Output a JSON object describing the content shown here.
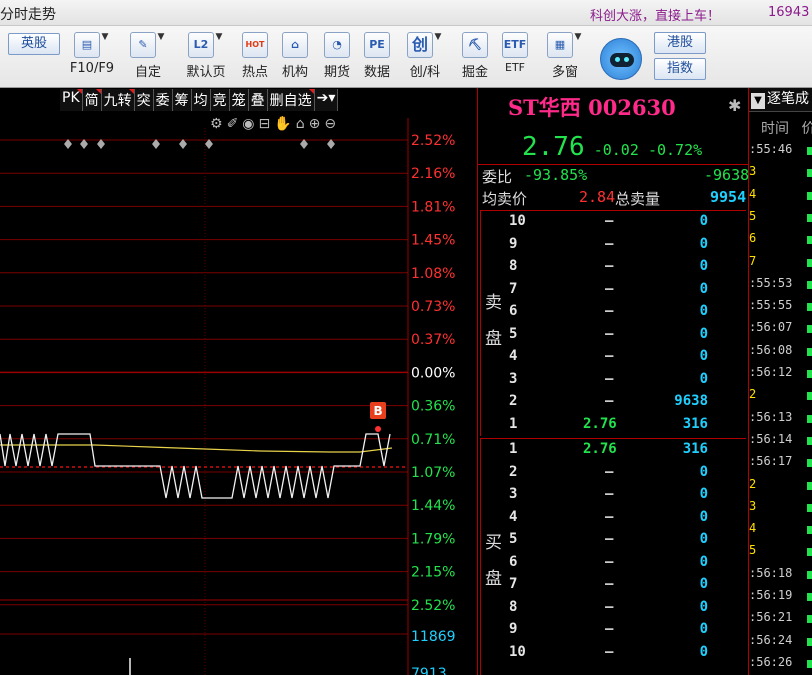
{
  "window": {
    "title": "分时走势",
    "slogan": "科创大涨，直接上车！",
    "phone": "16943"
  },
  "toolbar": {
    "hk_stock": "英股",
    "f10": "F10/F9",
    "custom": "自定",
    "default_page": "默认页",
    "hot": "热点",
    "institution": "机构",
    "futures": "期货",
    "data": "数据",
    "chuang_ke": "创/科",
    "juejin": "掘金",
    "etf": "ETF",
    "multi_window": "多窗",
    "hk_shares": "港股",
    "index": "指数",
    "icon_text": {
      "default_page": "L2",
      "hot": "HOT",
      "data": "PE",
      "chuang": "创",
      "etf": "ETF"
    }
  },
  "chart": {
    "tabs": [
      "PK",
      "简",
      "九转",
      "突",
      "委",
      "筹",
      "均",
      "竞",
      "笼",
      "叠",
      "删自选"
    ],
    "tools_icons": [
      "settings-icon",
      "pen-icon",
      "eye-icon",
      "lock-icon",
      "hand-icon",
      "lock-closed-icon",
      "zoom-in-icon",
      "zoom-out-icon"
    ],
    "y_labels": [
      {
        "text": "2.52%",
        "color": "#ff3030"
      },
      {
        "text": "2.16%",
        "color": "#ff3030"
      },
      {
        "text": "1.81%",
        "color": "#ff3030"
      },
      {
        "text": "1.45%",
        "color": "#ff3030"
      },
      {
        "text": "1.08%",
        "color": "#ff3030"
      },
      {
        "text": "0.73%",
        "color": "#ff3030"
      },
      {
        "text": "0.37%",
        "color": "#ff3030"
      },
      {
        "text": "0.00%",
        "color": "#ffffff"
      },
      {
        "text": "0.36%",
        "color": "#22e34d"
      },
      {
        "text": "0.71%",
        "color": "#22e34d"
      },
      {
        "text": "1.07%",
        "color": "#22e34d"
      },
      {
        "text": "1.44%",
        "color": "#22e34d"
      },
      {
        "text": "1.79%",
        "color": "#22e34d"
      },
      {
        "text": "2.15%",
        "color": "#22e34d"
      },
      {
        "text": "2.52%",
        "color": "#22e34d"
      }
    ],
    "volume_labels": [
      "11869",
      "7913"
    ],
    "marker": "B"
  },
  "quote": {
    "name": "ST华西",
    "code": "002630",
    "price": "2.76",
    "change": "-0.02",
    "pct": "-0.72%",
    "weibi_label": "委比",
    "weibi_pct": "-93.85%",
    "weibi_val": "-9638",
    "avg_sell_label": "均卖价",
    "avg_sell_price": "2.84",
    "total_sell_label": "总卖量",
    "total_sell": "9954",
    "sell_side": [
      "卖",
      "盘"
    ],
    "buy_side": [
      "买",
      "盘"
    ],
    "sell_levels": [
      {
        "n": "10",
        "p": "–",
        "v": "0"
      },
      {
        "n": "9",
        "p": "–",
        "v": "0"
      },
      {
        "n": "8",
        "p": "–",
        "v": "0"
      },
      {
        "n": "7",
        "p": "–",
        "v": "0"
      },
      {
        "n": "6",
        "p": "–",
        "v": "0"
      },
      {
        "n": "5",
        "p": "–",
        "v": "0"
      },
      {
        "n": "4",
        "p": "–",
        "v": "0"
      },
      {
        "n": "3",
        "p": "–",
        "v": "0"
      },
      {
        "n": "2",
        "p": "–",
        "v": "9638"
      },
      {
        "n": "1",
        "p": "2.76",
        "v": "316"
      }
    ],
    "buy_levels": [
      {
        "n": "1",
        "p": "2.76",
        "v": "316"
      },
      {
        "n": "2",
        "p": "–",
        "v": "0"
      },
      {
        "n": "3",
        "p": "–",
        "v": "0"
      },
      {
        "n": "4",
        "p": "–",
        "v": "0"
      },
      {
        "n": "5",
        "p": "–",
        "v": "0"
      },
      {
        "n": "6",
        "p": "–",
        "v": "0"
      },
      {
        "n": "7",
        "p": "–",
        "v": "0"
      },
      {
        "n": "8",
        "p": "–",
        "v": "0"
      },
      {
        "n": "9",
        "p": "–",
        "v": "0"
      },
      {
        "n": "10",
        "p": "–",
        "v": "0"
      }
    ]
  },
  "ticks": {
    "header": "逐笔成",
    "col_time": "时间",
    "col_price": "价",
    "rows": [
      {
        "t": ":55:46",
        "c": "#cfcfcf"
      },
      {
        "t": "3",
        "c": "#ffe000"
      },
      {
        "t": "4",
        "c": "#ffe000"
      },
      {
        "t": "5",
        "c": "#ffe000"
      },
      {
        "t": "6",
        "c": "#ffe000"
      },
      {
        "t": "7",
        "c": "#ffe000"
      },
      {
        "t": ":55:53",
        "c": "#cfcfcf"
      },
      {
        "t": ":55:55",
        "c": "#cfcfcf"
      },
      {
        "t": ":56:07",
        "c": "#cfcfcf"
      },
      {
        "t": ":56:08",
        "c": "#cfcfcf"
      },
      {
        "t": ":56:12",
        "c": "#cfcfcf"
      },
      {
        "t": "2",
        "c": "#ffe000"
      },
      {
        "t": ":56:13",
        "c": "#cfcfcf"
      },
      {
        "t": ":56:14",
        "c": "#cfcfcf"
      },
      {
        "t": ":56:17",
        "c": "#cfcfcf"
      },
      {
        "t": "2",
        "c": "#ffe000"
      },
      {
        "t": "3",
        "c": "#ffe000"
      },
      {
        "t": "4",
        "c": "#ffe000"
      },
      {
        "t": "5",
        "c": "#ffe000"
      },
      {
        "t": ":56:18",
        "c": "#cfcfcf"
      },
      {
        "t": ":56:19",
        "c": "#cfcfcf"
      },
      {
        "t": ":56:21",
        "c": "#cfcfcf"
      },
      {
        "t": ":56:24",
        "c": "#cfcfcf"
      },
      {
        "t": ":56:26",
        "c": "#cfcfcf"
      }
    ]
  }
}
